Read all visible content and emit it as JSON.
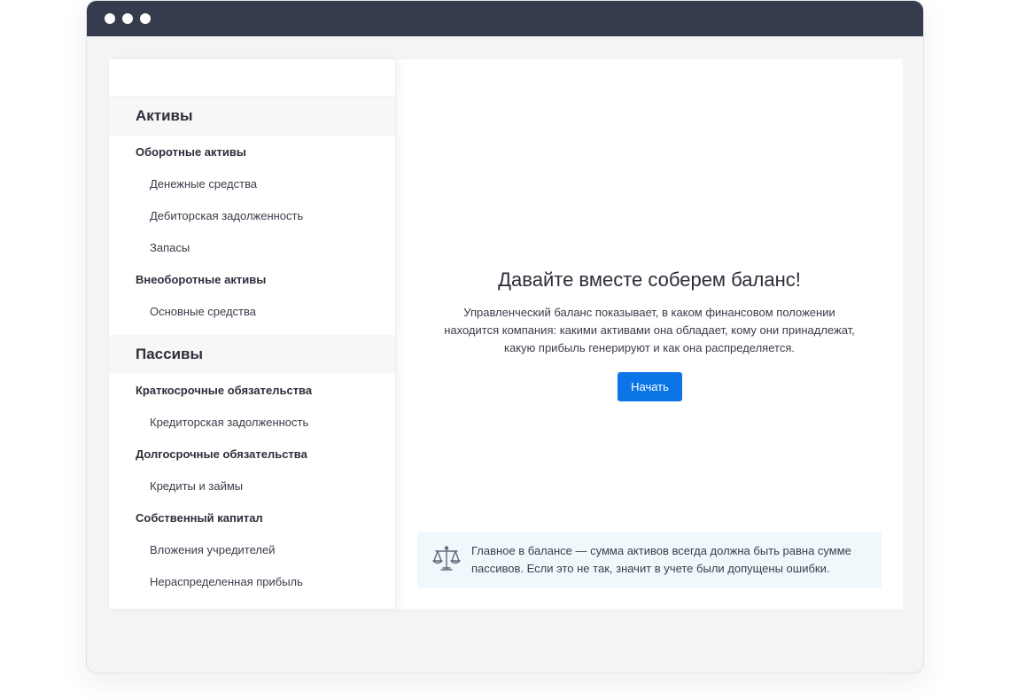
{
  "window": {
    "colors": {
      "titlebar": "#363b4e",
      "accent": "#0b74e6",
      "hint_bg": "#f1f8fb"
    }
  },
  "sidebar": {
    "sections": [
      {
        "title": "Активы",
        "groups": [
          {
            "label": "Оборотные активы",
            "items": [
              "Денежные средства",
              "Дебиторская задолженность",
              "Запасы"
            ]
          },
          {
            "label": "Внеоборотные активы",
            "items": [
              "Основные средства"
            ]
          }
        ]
      },
      {
        "title": "Пассивы",
        "groups": [
          {
            "label": "Краткосрочные обязательства",
            "items": [
              "Кредиторская задолженность"
            ]
          },
          {
            "label": "Долгосрочные обязательства",
            "items": [
              "Кредиты и займы"
            ]
          },
          {
            "label": "Собственный капитал",
            "items": [
              "Вложения учредителей",
              "Нераспределенная прибыль"
            ]
          }
        ]
      }
    ]
  },
  "main": {
    "title": "Давайте вместе соберем баланс!",
    "description_lines": [
      "Управленческий баланс показывает, в каком финансовом положении",
      "находится компания: какими активами она обладает, кому они принадлежат,",
      "какую прибыль генерируют и как она распределяется."
    ],
    "start_label": "Начать",
    "hint": {
      "icon": "scales-icon",
      "lines": [
        "Главное в балансе — сумма активов всегда должна быть равна сумме",
        "пассивов. Если это не так, значит в учете были допущены ошибки."
      ]
    }
  }
}
